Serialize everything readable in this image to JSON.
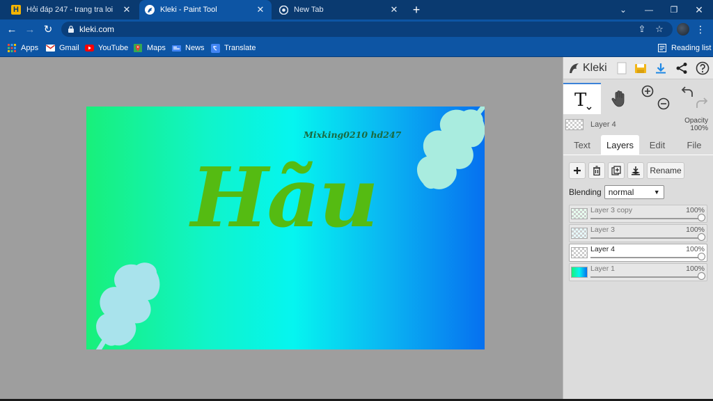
{
  "browser": {
    "tabs": [
      {
        "label": "Hỏi đáp 247 - trang tra loi",
        "icon_letter": "H"
      },
      {
        "label": "Kleki - Paint Tool"
      },
      {
        "label": "New Tab"
      }
    ],
    "url": "kleki.com"
  },
  "bookmarks": [
    {
      "label": "Apps"
    },
    {
      "label": "Gmail"
    },
    {
      "label": "YouTube"
    },
    {
      "label": "Maps"
    },
    {
      "label": "News"
    },
    {
      "label": "Translate"
    }
  ],
  "reading_list": "Reading list",
  "canvas": {
    "watermark": "Mixking0210 hd247",
    "title_text": "Hãu"
  },
  "kleki": {
    "logo": "Kleki",
    "current_layer": "Layer 4",
    "opacity_label": "Opacity",
    "opacity_value": "100%",
    "tabs": [
      {
        "label": "Text"
      },
      {
        "label": "Layers"
      },
      {
        "label": "Edit"
      },
      {
        "label": "File"
      }
    ],
    "rename_label": "Rename",
    "blending_label": "Blending",
    "blending_value": "normal",
    "layers": [
      {
        "name": "Layer 3 copy",
        "opacity": "100%"
      },
      {
        "name": "Layer 3",
        "opacity": "100%"
      },
      {
        "name": "Layer 4",
        "opacity": "100%"
      },
      {
        "name": "Layer 1",
        "opacity": "100%"
      }
    ]
  },
  "colors": {
    "chrome_frame": "#0a3a70",
    "chrome_toolbar": "#0d55a4",
    "text_green": "#55bb12",
    "leaf_color": "#a9ecdf"
  }
}
